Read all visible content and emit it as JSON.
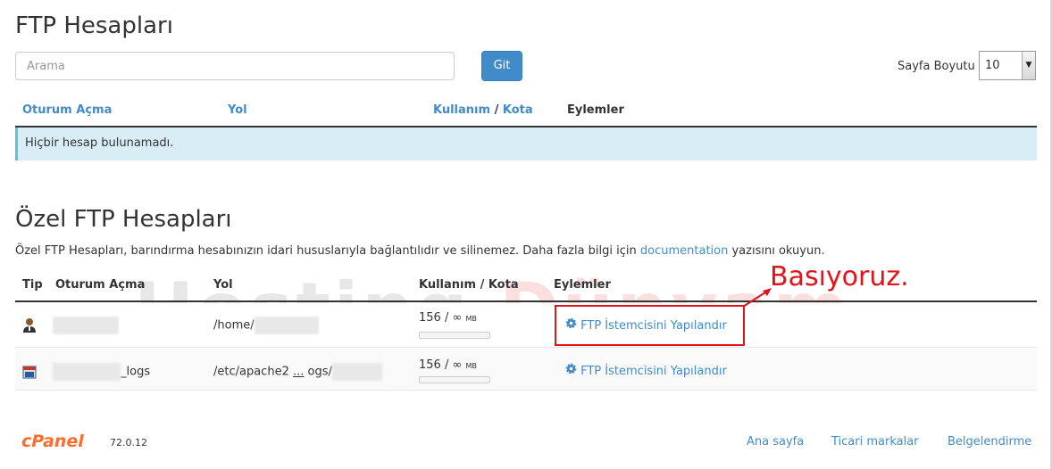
{
  "page": {
    "title": "FTP Hesapları"
  },
  "search": {
    "placeholder": "Arama",
    "go_label": "Git"
  },
  "pagesize": {
    "label": "Sayfa Boyutu",
    "value": "10"
  },
  "accounts_table": {
    "headers": {
      "login": "Oturum Açma",
      "path": "Yol",
      "usage": "Kullanım",
      "sep": " / ",
      "quota": "Kota",
      "actions": "Eylemler"
    },
    "empty_message": "Hiçbir hesap bulunamadı."
  },
  "special": {
    "title": "Özel FTP Hesapları",
    "description_pre": "Özel FTP Hesapları, barındırma hesabınızın idari hususlarıyla bağlantılıdır ve silinemez. Daha fazla bilgi için ",
    "description_link": "documentation",
    "description_post": " yazısını okuyun.",
    "headers": {
      "type": "Tip",
      "login": "Oturum Açma",
      "path": "Yol",
      "usage": "Kullanım / Kota",
      "actions": "Eylemler"
    },
    "rows": [
      {
        "login": "",
        "path": "/home/",
        "usage": "156 / ∞",
        "unit": "MB",
        "action": "FTP İstemcisini Yapılandır"
      },
      {
        "login_prefix": "",
        "login": "_logs",
        "path": "/etc/apache2 ",
        "path_ellipsis": "...",
        "path_post": " ogs/",
        "usage": "156 / ∞",
        "unit": "MB",
        "action": "FTP İstemcisini Yapılandır"
      }
    ]
  },
  "annotation": {
    "text": "Basıyoruz.",
    "color": "#e0141a"
  },
  "watermark": {
    "part1": "Hosting ",
    "part2": "Dünyam"
  },
  "footer": {
    "logo": "cPanel",
    "version": "72.0.12",
    "links": [
      "Ana sayfa",
      "Ticari markalar",
      "Belgelendirme"
    ]
  },
  "colors": {
    "link": "#428bca",
    "info_bg": "#d9edf7",
    "accent": "#ff6c2c"
  }
}
